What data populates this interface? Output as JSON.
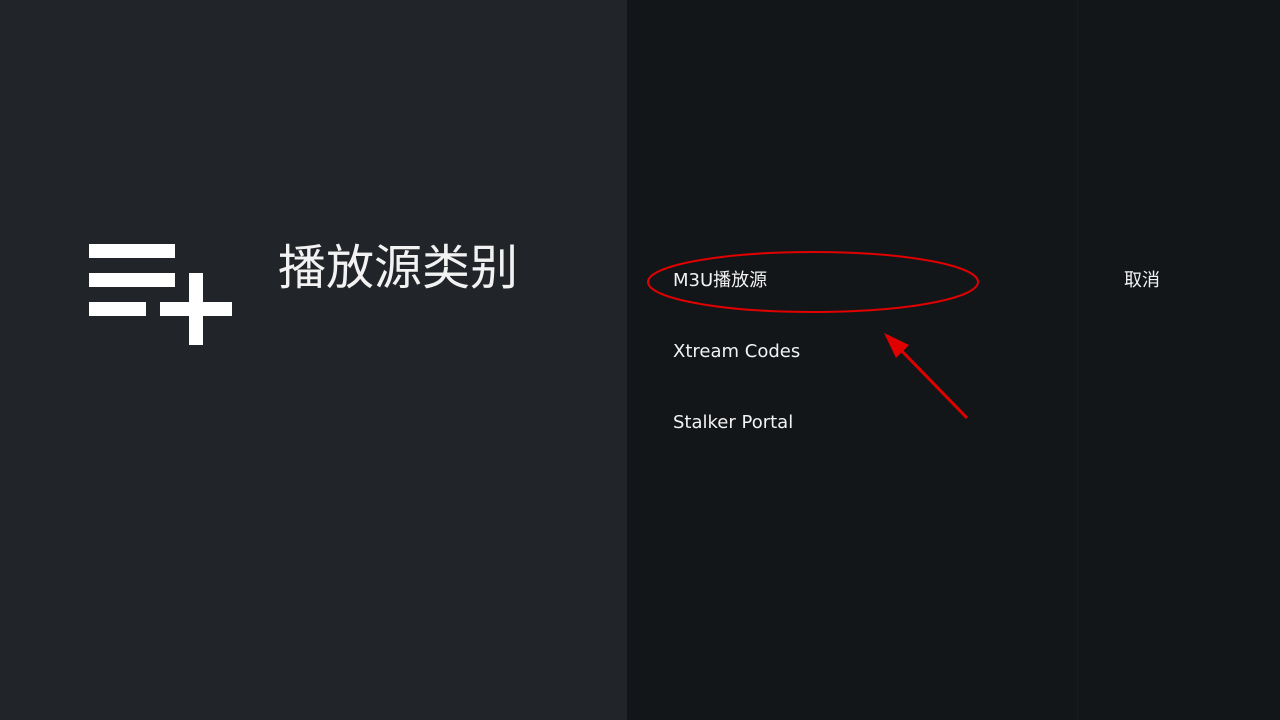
{
  "header": {
    "title": "播放源类别",
    "icon": "playlist-add-icon"
  },
  "options": [
    {
      "label": "M3U播放源"
    },
    {
      "label": "Xtream Codes"
    },
    {
      "label": "Stalker Portal"
    }
  ],
  "actions": {
    "cancel_label": "取消"
  },
  "colors": {
    "left_panel_bg": "#212428",
    "dialog_bg": "#131619",
    "text": "#f2f2f2",
    "annotation": "#e00000"
  }
}
